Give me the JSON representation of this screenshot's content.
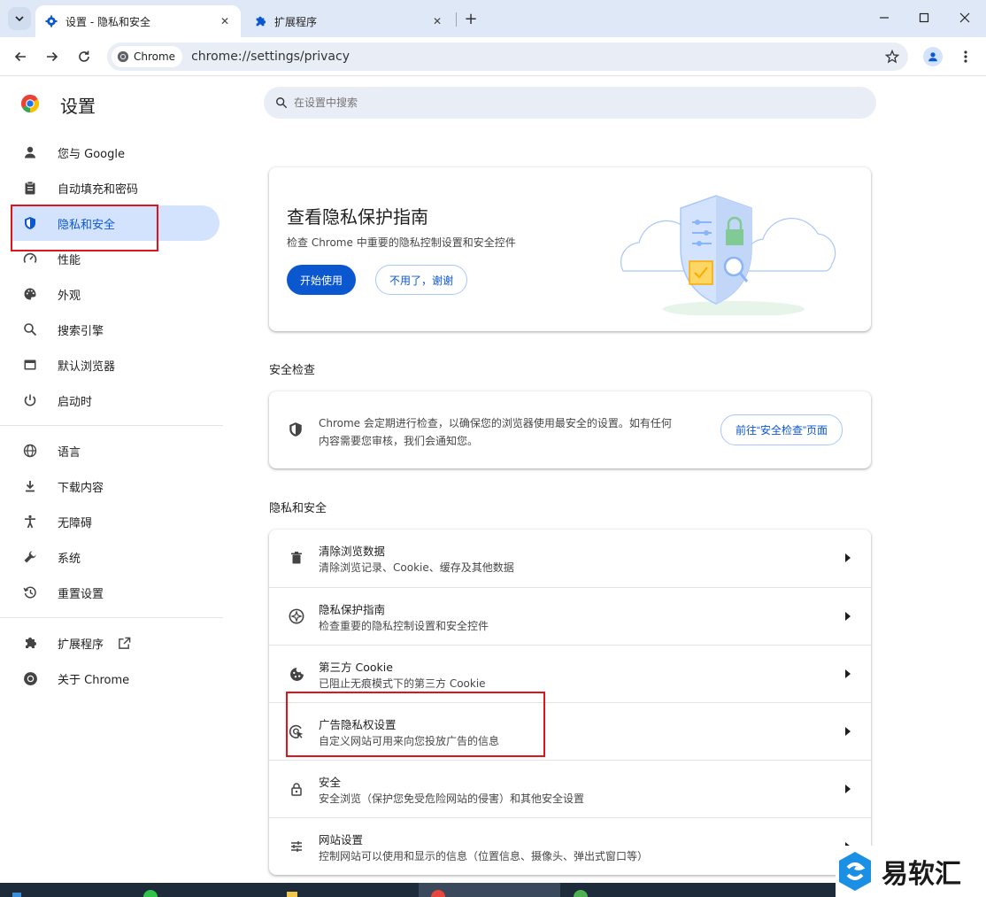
{
  "browser": {
    "tabs": [
      {
        "title": "设置 - 隐私和安全",
        "active": true,
        "icon": "gear-icon"
      },
      {
        "title": "扩展程序",
        "active": false,
        "icon": "puzzle-icon"
      }
    ],
    "site_chip": "Chrome",
    "url": "chrome://settings/privacy"
  },
  "header": {
    "title": "设置",
    "search_placeholder": "在设置中搜索"
  },
  "sidebar": {
    "items": [
      {
        "label": "您与 Google",
        "icon": "person-icon"
      },
      {
        "label": "自动填充和密码",
        "icon": "clipboard-icon"
      },
      {
        "label": "隐私和安全",
        "icon": "shield-icon",
        "selected": true
      },
      {
        "label": "性能",
        "icon": "speedometer-icon"
      },
      {
        "label": "外观",
        "icon": "palette-icon"
      },
      {
        "label": "搜索引擎",
        "icon": "search-icon"
      },
      {
        "label": "默认浏览器",
        "icon": "browser-icon"
      },
      {
        "label": "启动时",
        "icon": "power-icon"
      },
      {
        "label": "语言",
        "icon": "globe-icon"
      },
      {
        "label": "下载内容",
        "icon": "download-icon"
      },
      {
        "label": "无障碍",
        "icon": "accessibility-icon"
      },
      {
        "label": "系统",
        "icon": "wrench-icon"
      },
      {
        "label": "重置设置",
        "icon": "history-icon"
      },
      {
        "label": "扩展程序",
        "icon": "puzzle-icon"
      },
      {
        "label": "关于 Chrome",
        "icon": "chrome-icon"
      }
    ]
  },
  "promo": {
    "title": "查看隐私保护指南",
    "description": "检查 Chrome 中重要的隐私控制设置和安全控件",
    "primary_button": "开始使用",
    "secondary_button": "不用了，谢谢"
  },
  "safety_check": {
    "section_label": "安全检查",
    "text_line1": "Chrome 会定期进行检查，以确保您的浏览器使用最安全的设置。如有任何",
    "text_line2": "内容需要您审核，我们会通知您。",
    "button": "前往“安全检查”页面"
  },
  "privacy": {
    "section_label": "隐私和安全",
    "rows": [
      {
        "title": "清除浏览数据",
        "subtitle": "清除浏览记录、Cookie、缓存及其他数据",
        "icon": "trash-icon"
      },
      {
        "title": "隐私保护指南",
        "subtitle": "检查重要的隐私控制设置和安全控件",
        "icon": "compass-icon"
      },
      {
        "title": "第三方 Cookie",
        "subtitle": "已阻止无痕模式下的第三方 Cookie",
        "icon": "cookie-icon"
      },
      {
        "title": "广告隐私权设置",
        "subtitle": "自定义网站可用来向您投放广告的信息",
        "icon": "ad-privacy-icon"
      },
      {
        "title": "安全",
        "subtitle": "安全浏览（保护您免受危险网站的侵害）和其他安全设置",
        "icon": "lock-icon"
      },
      {
        "title": "网站设置",
        "subtitle": "控制网站可以使用和显示的信息（位置信息、摄像头、弹出式窗口等）",
        "icon": "sliders-icon"
      }
    ]
  },
  "watermark": {
    "text": "易软汇"
  },
  "colors": {
    "accent": "#0b57d0",
    "selected_bg": "#d3e3fd",
    "annotation": "#e0141b",
    "tabstrip": "#dfe8f6"
  }
}
